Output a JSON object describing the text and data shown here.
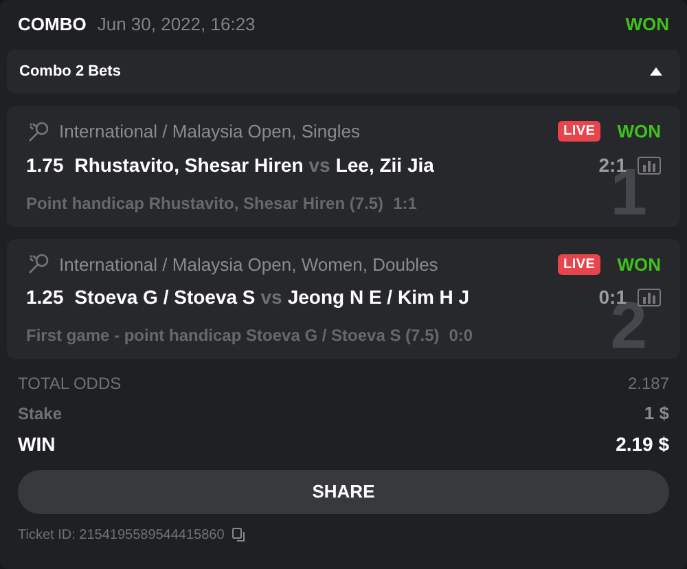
{
  "header": {
    "title": "COMBO",
    "date": "Jun 30, 2022, 16:23",
    "status": "WON"
  },
  "combo": {
    "label": "Combo 2 Bets",
    "expanded": true
  },
  "bets": [
    {
      "number": "1",
      "league": "International / Malaysia Open, Singles",
      "live": true,
      "live_label": "LIVE",
      "status": "WON",
      "odds": "1.75",
      "home": "Rhustavito, Shesar Hiren",
      "vs": "vs",
      "away": "Lee, Zii Jia",
      "score": "2:1",
      "market": "Point handicap Rhustavito, Shesar Hiren (7.5)",
      "market_score": "1:1"
    },
    {
      "number": "2",
      "league": "International / Malaysia Open, Women, Doubles",
      "live": true,
      "live_label": "LIVE",
      "status": "WON",
      "odds": "1.25",
      "home": "Stoeva G / Stoeva S",
      "vs": "vs",
      "away": "Jeong N E / Kim H J",
      "score": "0:1",
      "market": "First game - point handicap Stoeva G / Stoeva S (7.5)",
      "market_score": "0:0"
    }
  ],
  "summary": [
    {
      "kind": "odds",
      "label": "TOTAL ODDS",
      "value": "2.187"
    },
    {
      "kind": "stake",
      "label": "Stake",
      "value": "1 $"
    },
    {
      "kind": "win",
      "label": "WIN",
      "value": "2.19 $"
    }
  ],
  "share_button": "SHARE",
  "ticket": "Ticket ID: 2154195589544415860"
}
